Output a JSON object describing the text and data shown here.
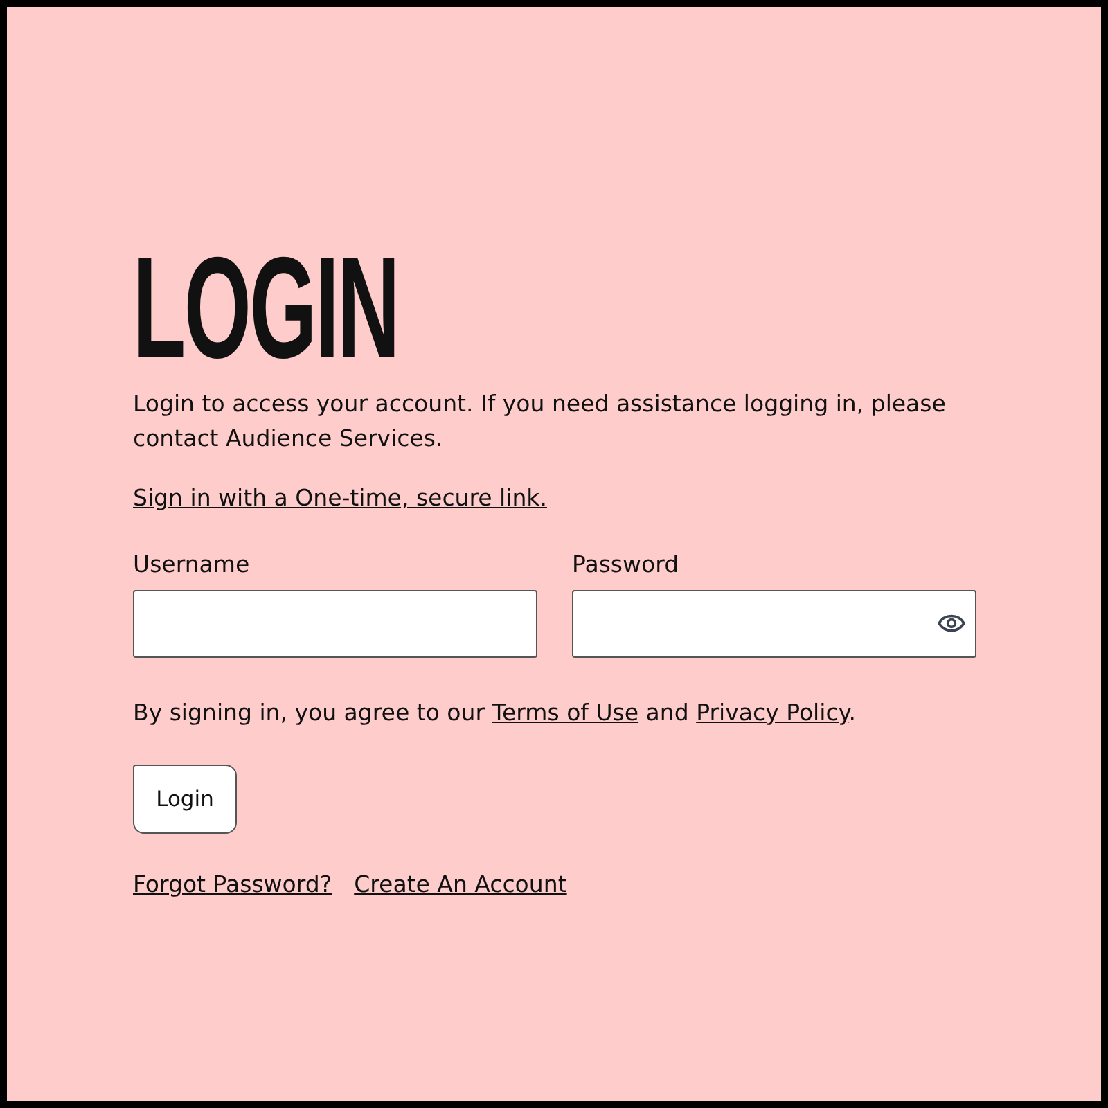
{
  "title": "LOGIN",
  "intro": "Login to access your account. If you need assistance logging in, please contact Audience Services.",
  "magic_link": "Sign in with a One-time, secure link.",
  "fields": [
    {
      "label": "Username",
      "kind": "text"
    },
    {
      "label": "Password",
      "kind": "password"
    }
  ],
  "consent": {
    "before": "By signing in, you agree to our ",
    "terms_link": "Terms of Use",
    "middle": " and ",
    "privacy_link": "Privacy Policy",
    "after": "."
  },
  "login_button": "Login",
  "links": [
    "Forgot Password?",
    "Create An Account"
  ]
}
